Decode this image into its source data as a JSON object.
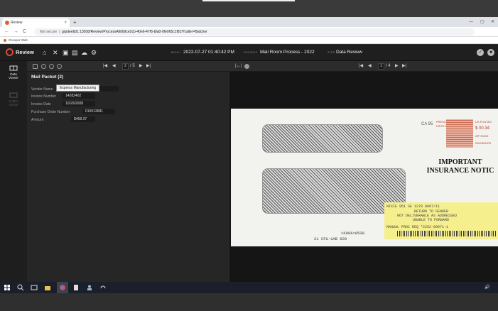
{
  "browser": {
    "tab_title": "Review",
    "new_tab_glyph": "+",
    "close_glyph": "×",
    "win_min": "—",
    "win_max": "▢",
    "win_close": "✕",
    "nav_back": "←",
    "nav_forward": "→",
    "nav_reload": "C",
    "security": "Not secure",
    "url": "grpdeeb01:13930/Review/ProcessAll/0bfce2cb-40e6-47f6-bfa0-0fe065c1f81f?caller=Batcher",
    "bookmark": "Grooper Web"
  },
  "app": {
    "name": "Review",
    "icons": [
      "home-icon",
      "tools-icon",
      "archive-icon",
      "inbox-icon",
      "cloud-icon",
      "settings-icon"
    ],
    "batch_label": "BATCH",
    "batch_value": "2022-07-27 01:40:42 PM",
    "process_label": "PROCESS",
    "process_value": "Mail Room Process - 2022",
    "step_label": "STEP",
    "step_value": "Data Review",
    "check_glyph": "✓",
    "stop_glyph": "■"
  },
  "sidebar": {
    "items": [
      {
        "label_1": "Data",
        "label_2": "Viewer",
        "icon": "data-viewer-icon",
        "active": true
      },
      {
        "label_1": "Folder",
        "label_2": "Viewer",
        "icon": "folder-viewer-icon",
        "active": false
      }
    ]
  },
  "data_panel": {
    "pager_first": "|◀",
    "pager_prev": "◀",
    "page_current": "2",
    "page_total": "/ 5",
    "pager_next": "▶",
    "pager_last": "▶|",
    "title": "Mail Packet (2)",
    "fields": [
      {
        "label": "Vendor Name",
        "value": "Express Manufacturing"
      },
      {
        "label": "Invoice Number",
        "value": "14282402"
      },
      {
        "label": "Invoice Date",
        "value": "10/29/2008"
      },
      {
        "label": "Purchase Order Number",
        "value": "010013681"
      },
      {
        "label": "Amount",
        "value": "$458.37"
      }
    ],
    "tooltip": "Express Manufacturing"
  },
  "image_panel": {
    "fit_glyph": "|↔|",
    "info_glyph": "i",
    "pager_first": "|◀",
    "pager_prev": "◀",
    "page_current": "1",
    "page_total": "/ 4",
    "pager_next": "▶",
    "pager_last": "▶|",
    "envelope": {
      "postal_code": "CA 95",
      "postage_1": "PRESORTED",
      "postage_2": "FIRST-CLASS",
      "postage_3": "US POSTAG",
      "postage_4": "ZIP 95103",
      "postage_5": "0000381875",
      "postage_6": "$ 00.34",
      "headline_1": "IMPORTANT",
      "headline_2": "INSURANCE NOTIC",
      "sticker_1": "NIXIE    951   SE 1270    0007/11",
      "sticker_2": "RETURN TO SENDER",
      "sticker_3": "NOT DELIVERABLE AS ADDRESSED",
      "sticker_4": "UNABLE TO FORWARD",
      "sticker_5": "MANUAL PROC REQ    *2252-00971-1",
      "bottom_1": "16996>9538",
      "bottom_2": "21    CFU-1AB   920"
    }
  },
  "taskbar": {
    "clock_glyph": "🔊"
  }
}
